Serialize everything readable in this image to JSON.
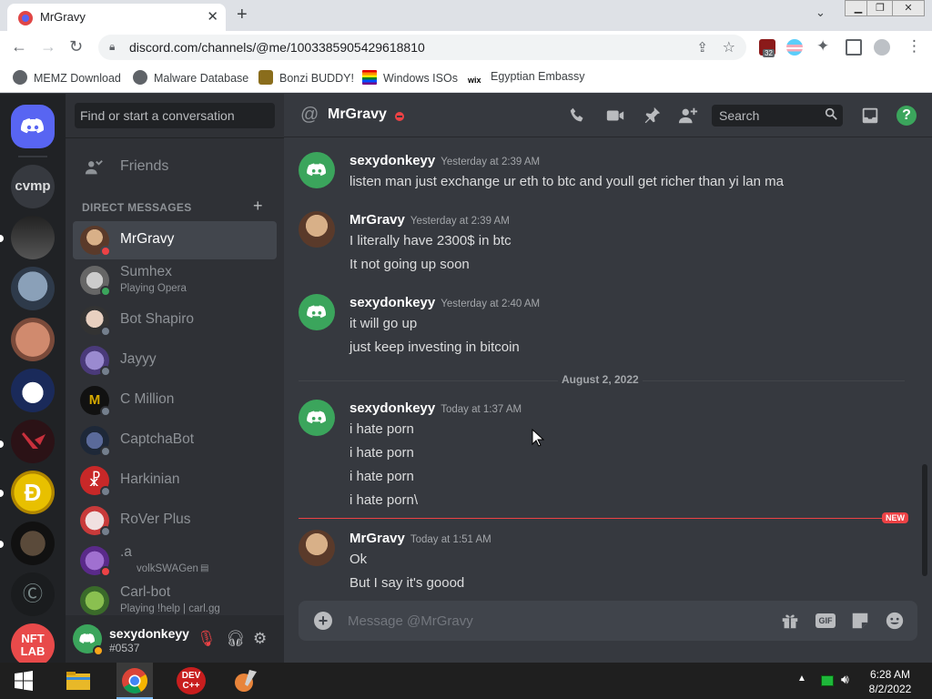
{
  "browser": {
    "tab_title": "MrGravy",
    "tab_close": "✕",
    "new_tab": "+",
    "url": "discord.com/channels/@me/1003385905429618810",
    "extension_badge": "32",
    "bookmarks": [
      {
        "label": "MEMZ Download"
      },
      {
        "label": "Malware Database"
      },
      {
        "label": "Bonzi BUDDY!"
      },
      {
        "label": "Windows ISOs"
      },
      {
        "label": "Egyptian Embassy"
      }
    ]
  },
  "guilds": [
    {
      "label": "cvmp"
    },
    {
      "label": "NFT LAB"
    }
  ],
  "sidebar": {
    "search_placeholder": "Find or start a conversation",
    "friends_label": "Friends",
    "dm_header": "DIRECT MESSAGES",
    "add": "+",
    "dms": [
      {
        "name": "MrGravy",
        "sub": "",
        "active": true
      },
      {
        "name": "Sumhex",
        "sub": "Playing Opera"
      },
      {
        "name": "Bot Shapiro",
        "sub": ""
      },
      {
        "name": "Jayyy",
        "sub": ""
      },
      {
        "name": "C Million",
        "sub": ""
      },
      {
        "name": "CaptchaBot",
        "sub": ""
      },
      {
        "name": "Harkinian",
        "sub": ""
      },
      {
        "name": "RoVer Plus",
        "sub": ""
      },
      {
        "name": ".a",
        "sub": "volkSWAGen"
      },
      {
        "name": "Carl-bot",
        "sub": "Playing !help | carl.gg"
      }
    ]
  },
  "user_panel": {
    "username": "sexydonkeyy",
    "tag": "#0537"
  },
  "chat": {
    "header_name": "MrGravy",
    "search_placeholder": "Search",
    "date_divider": "August 2, 2022",
    "new_label": "NEW",
    "composer_placeholder": "Message @MrGravy",
    "messages": [
      {
        "author": "sexydonkeyy",
        "time": "Yesterday at 2:39 AM",
        "lines": [
          "listen man just exchange ur eth to btc and youll get richer than yi lan ma"
        ]
      },
      {
        "author": "MrGravy",
        "time": "Yesterday at 2:39 AM",
        "lines": [
          "I literally have 2300$ in btc",
          "It not going up soon"
        ]
      },
      {
        "author": "sexydonkeyy",
        "time": "Yesterday at 2:40 AM",
        "lines": [
          "it will go up",
          "just keep investing in bitcoin"
        ]
      },
      {
        "author": "sexydonkeyy",
        "time": "Today at 1:37 AM",
        "lines": [
          "i hate porn",
          "i hate porn",
          "i hate porn",
          "i hate porn\\"
        ]
      },
      {
        "author": "MrGravy",
        "time": "Today at 1:51 AM",
        "lines": [
          "Ok",
          "But I say it's goood"
        ]
      }
    ]
  },
  "taskbar": {
    "time": "6:28 AM",
    "date": "8/2/2022"
  },
  "colors": {
    "blurple": "#5865f2",
    "green": "#3ba55c",
    "dnd_red": "#ed4245",
    "bg_chat": "#36393f",
    "bg_sidebar": "#2f3136",
    "bg_guilds": "#202225"
  }
}
